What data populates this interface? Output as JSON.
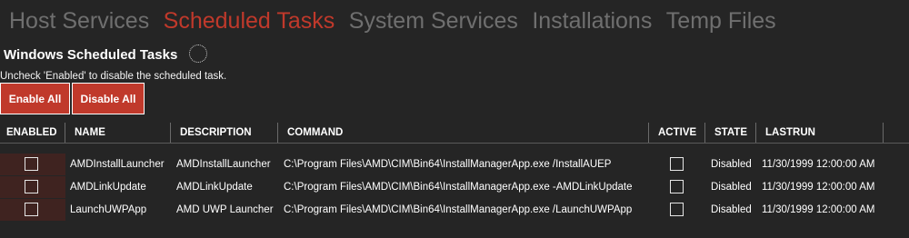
{
  "tabs": [
    {
      "label": "Host Services",
      "active": false
    },
    {
      "label": "Scheduled Tasks",
      "active": true
    },
    {
      "label": "System Services",
      "active": false
    },
    {
      "label": "Installations",
      "active": false
    },
    {
      "label": "Temp Files",
      "active": false
    }
  ],
  "section": {
    "title": "Windows Scheduled Tasks",
    "hint": "Uncheck 'Enabled' to disable the scheduled task."
  },
  "buttons": {
    "enable_all": "Enable All",
    "disable_all": "Disable All"
  },
  "table": {
    "columns": [
      "ENABLED",
      "NAME",
      "DESCRIPTION",
      "COMMAND",
      "ACTIVE",
      "STATE",
      "LASTRUN"
    ],
    "rows": [
      {
        "enabled": false,
        "name": "AMDInstallLauncher",
        "description": "AMDInstallLauncher",
        "command": "C:\\Program Files\\AMD\\CIM\\Bin64\\InstallManagerApp.exe /InstallAUEP",
        "active": false,
        "state": "Disabled",
        "lastrun": "11/30/1999 12:00:00 AM"
      },
      {
        "enabled": false,
        "name": "AMDLinkUpdate",
        "description": "AMDLinkUpdate",
        "command": "C:\\Program Files\\AMD\\CIM\\Bin64\\InstallManagerApp.exe -AMDLinkUpdate",
        "active": false,
        "state": "Disabled",
        "lastrun": "11/30/1999 12:00:00 AM"
      },
      {
        "enabled": false,
        "name": "LaunchUWPApp",
        "description": "AMD UWP Launcher",
        "command": "C:\\Program Files\\AMD\\CIM\\Bin64\\InstallManagerApp.exe /LaunchUWPApp",
        "active": false,
        "state": "Disabled",
        "lastrun": "11/30/1999 12:00:00 AM"
      }
    ]
  },
  "colors": {
    "accent": "#c0392b",
    "background": "#252525",
    "inactive_tab": "#6f6f6f",
    "enabled_cell_bg": "#3f2320"
  },
  "icons": {
    "loading": "loading-spinner-icon"
  }
}
